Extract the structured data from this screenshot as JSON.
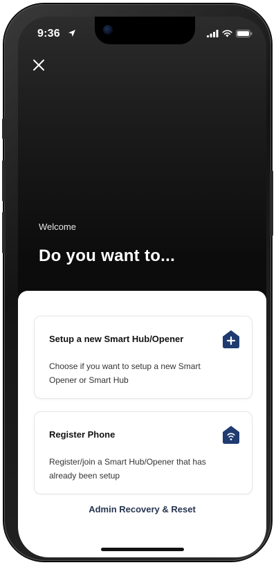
{
  "status_bar": {
    "time": "9:36"
  },
  "header": {
    "welcome": "Welcome",
    "headline": "Do you want to..."
  },
  "options": [
    {
      "title": "Setup a new Smart Hub/Opener",
      "description": "Choose if you want to setup a new Smart Opener or Smart Hub",
      "icon": "house-plus-icon"
    },
    {
      "title": "Register Phone",
      "description": "Register/join a Smart Hub/Opener that has already been setup",
      "icon": "house-wifi-icon"
    }
  ],
  "footer": {
    "admin_link": "Admin Recovery & Reset"
  },
  "colors": {
    "accent": "#1f3b70",
    "background_dark": "#0c0c0c",
    "sheet": "#ffffff"
  }
}
